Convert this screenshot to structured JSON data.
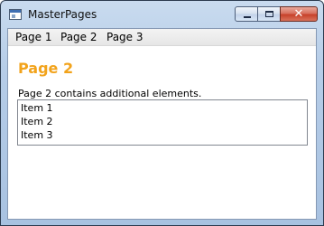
{
  "window": {
    "title": "MasterPages",
    "close_glyph": "✕"
  },
  "menu": {
    "items": [
      {
        "label": "Page 1"
      },
      {
        "label": "Page 2"
      },
      {
        "label": "Page 3"
      }
    ]
  },
  "content": {
    "heading": "Page 2",
    "heading_color": "#f2a31b",
    "description": "Page 2 contains additional elements.",
    "list_items": [
      {
        "label": "Item 1"
      },
      {
        "label": "Item 2"
      },
      {
        "label": "Item 3"
      }
    ]
  }
}
